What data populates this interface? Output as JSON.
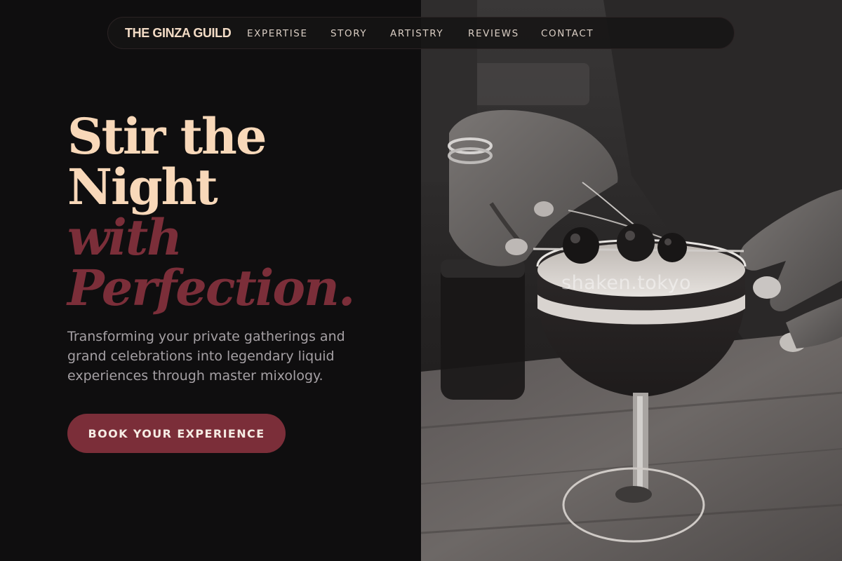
{
  "nav": {
    "brand": "THE GINZA GUILD",
    "links": [
      "EXPERTISE",
      "STORY",
      "ARTISTRY",
      "REVIEWS",
      "CONTACT"
    ]
  },
  "hero": {
    "line1": "Stir the",
    "line2": "Night",
    "line3": "with",
    "line4": "Perfection.",
    "subtitle": "Transforming your private gatherings and grand celebrations into legendary liquid experiences through master mixology.",
    "cta_label": "BOOK YOUR EXPERIENCE"
  },
  "image": {
    "watermark": "shaken.tokyo",
    "subject": "cocktail-photo"
  },
  "colors": {
    "background": "#0f0e0f",
    "accent_cream": "#f8d8b9",
    "accent_wine": "#7b2e39",
    "subtitle_gray": "#a5a0a4"
  }
}
